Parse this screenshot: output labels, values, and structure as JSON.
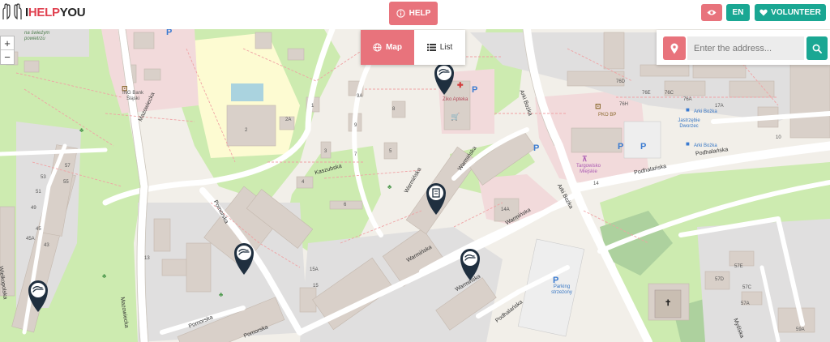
{
  "header": {
    "logo": {
      "i": "I",
      "help": "HELP",
      "you": "YOU"
    },
    "help_label": "HELP",
    "lang_label": "EN",
    "volunteer_label": "VOLUNTEER"
  },
  "view_toggle": {
    "map_label": "Map",
    "list_label": "List"
  },
  "search": {
    "placeholder": "Enter the address..."
  },
  "zoom": {
    "in": "+",
    "out": "−"
  },
  "map_labels": {
    "sweet_air": "na świeżym powietrzu",
    "ing": "ING Bank Śląski",
    "mazowiecka": "Mazowiecka",
    "mazowiecka2": "Mazowiecka",
    "kaszubska": "Kaszubska",
    "ziko": "Ziko Apteka",
    "warminska1": "Warmińska",
    "warminska2": "Warmińska",
    "warminska3": "Warmińska",
    "warminska4": "Warmińska",
    "warminska5": "Warmińska",
    "arki_bozka1": "Arki Bożka",
    "arki_bozka2": "Arki Bożka",
    "arki_bozka_stop": "Arki Bożka",
    "arki_bozka_stop2": "Arki Bożka",
    "jastrzebie": "Jastrzębie Dworzec",
    "podhalanska1": "Podhalańska",
    "podhalanska2": "Podhalańska",
    "podhalanska3": "Podhalańska",
    "pko": "PKO BP",
    "targowisko": "Targowisko Miejskie",
    "pomorska1": "Pomorska",
    "pomorska2": "Pomorska",
    "pomorska3": "Pomorska",
    "wielkopolska": "Wielkopolska",
    "parking": "Parking strzeżony",
    "myslska": "Myślska",
    "num_76d": "76D",
    "num_76e": "76E",
    "num_76c": "76C",
    "num_76a": "76A",
    "num_76h": "76H",
    "num_17a": "17A",
    "num_10": "10",
    "num_14": "14",
    "num_14a": "14A",
    "num_15a": "15A",
    "num_15": "15",
    "num_57e": "57E",
    "num_57d": "57D",
    "num_57c": "57C",
    "num_57a": "57A",
    "num_59a": "59A",
    "num_9": "9",
    "num_9a": "9A",
    "num_2a": "2A",
    "num_2": "2",
    "num_4": "4",
    "num_6": "6",
    "num_45a": "45A",
    "num_43": "43",
    "num_45": "45",
    "num_49": "49",
    "num_51": "51",
    "num_53": "53",
    "num_55": "55",
    "num_57": "57",
    "num_8": "8",
    "num_7": "7",
    "num_3": "3",
    "num_1": "1",
    "num_5": "5",
    "num_13": "13",
    "num_11": "11"
  },
  "colors": {
    "brand_red": "#e8737c",
    "teal": "#1aa793",
    "pin_dark": "#1f2f3f"
  },
  "markers": [
    "help-request-marker",
    "help-request-marker",
    "help-request-marker",
    "help-request-marker",
    "help-request-marker"
  ]
}
